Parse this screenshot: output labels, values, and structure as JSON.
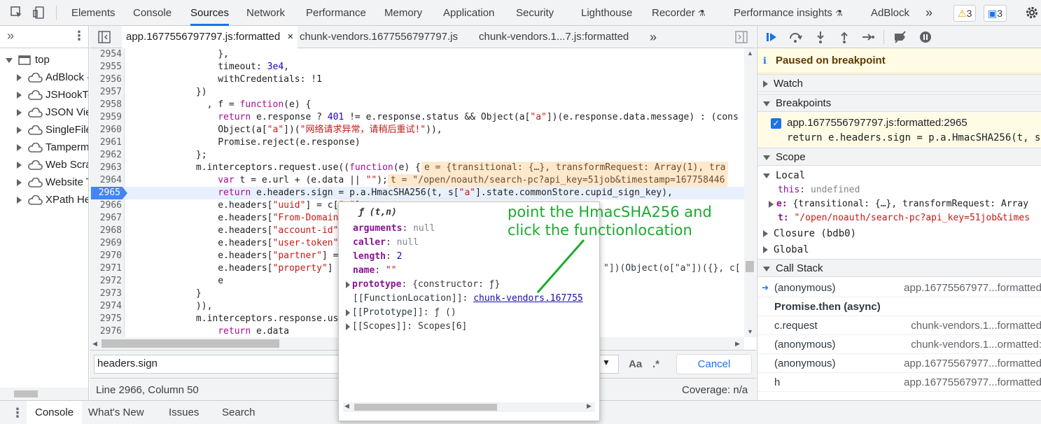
{
  "topbar": {
    "tabs": [
      "Elements",
      "Console",
      "Sources",
      "Network",
      "Performance",
      "Memory",
      "Application",
      "Security",
      "Lighthouse",
      "Recorder",
      "Performance insights",
      "AdBlock"
    ],
    "active_tab": "Sources",
    "more": "»",
    "warnings": "3",
    "messages": "3"
  },
  "navigator": {
    "more": "»",
    "top": "top",
    "items": [
      "AdBlock -",
      "JSHookTo",
      "JSON View",
      "SingleFile",
      "Tamperm",
      "Web Scrap",
      "Website T",
      "XPath Hel"
    ]
  },
  "editor": {
    "tabs": [
      "app.1677556797797.js:formatted",
      "chunk-vendors.1677556797797.js",
      "chunk-vendors.1...7.js:formatted"
    ],
    "close": "×",
    "more": "»"
  },
  "code": [
    {
      "n": "2954",
      "t": "                },"
    },
    {
      "n": "2955",
      "t": "                timeout: 3e4,"
    },
    {
      "n": "2956",
      "t": "                withCredentials: !1"
    },
    {
      "n": "2957",
      "t": "            })"
    },
    {
      "n": "2958",
      "t": "              , f = function(e) {"
    },
    {
      "n": "2959",
      "t": "                return e.response ? 401 != e.response.status && Object(a[\"a\"])(e.response.data.message) : (cons"
    },
    {
      "n": "2960",
      "t": "                Object(a[\"a\"])(\"网络请求异常，请稍后重试!\")),"
    },
    {
      "n": "2961",
      "t": "                Promise.reject(e.response)"
    },
    {
      "n": "2962",
      "t": "            };"
    },
    {
      "n": "2963",
      "t": "            m.interceptors.request.use((function(e) {"
    },
    {
      "n": "2964",
      "t": "                var t = e.url + (e.data || \"\");"
    },
    {
      "n": "2965",
      "t": "                return e.headers.sign = p.a.HmacSHA256(t, s[\"a\"].state.commonStore.cupid_sign_key),"
    },
    {
      "n": "2966",
      "t": "                e.headers[\"uuid\"] = c[\"a\"]..."
    },
    {
      "n": "2967",
      "t": "                e.headers[\"From-Domain\"]"
    },
    {
      "n": "2968",
      "t": "                e.headers[\"account-id\"]"
    },
    {
      "n": "2969",
      "t": "                e.headers[\"user-token\"]"
    },
    {
      "n": "2970",
      "t": "                e.headers[\"partner\"] = s"
    },
    {
      "n": "2971",
      "t": "                e.headers[\"property\"] = "
    },
    {
      "n": "2972",
      "t": "                e"
    },
    {
      "n": "2973",
      "t": "            }"
    },
    {
      "n": "2974",
      "t": "            )),"
    },
    {
      "n": "2975",
      "t": "            m.interceptors.response.use("
    },
    {
      "n": "2976",
      "t": "                return e.data"
    }
  ],
  "inline_values": {
    "line_2963": "e = {transitional: {…}, transformRequest: Array(1), tra",
    "line_2964": "t = \"/open/noauth/search-pc?api_key=51job&timestamp=167758446",
    "line_2971_tail": "\"])(Object(o[\"a\"])({}, c["
  },
  "search": {
    "value": "headers.sign",
    "case_label": "Aa",
    "regex_label": ".*",
    "cancel": "Cancel"
  },
  "status": {
    "position": "Line 2966, Column 50",
    "coverage": "Coverage: n/a"
  },
  "debugger": {
    "paused": "Paused on breakpoint",
    "watch": "Watch",
    "breakpoints": "Breakpoints",
    "bp_file": "app.1677556797797.js:formatted:2965",
    "bp_code": "return e.headers.sign = p.a.HmacSHA256(t, s[",
    "scope": "Scope",
    "local": "Local",
    "this_key": "this:",
    "this_val": "undefined",
    "e_key": "e:",
    "e_val": "{transitional: {…}, transformRequest: Array",
    "t_key": "t:",
    "t_val": "\"/open/noauth/search-pc?api_key=51job&times",
    "closure": "Closure (bdb0)",
    "global": "Global",
    "call_stack": "Call Stack",
    "frames": [
      {
        "name": "(anonymous)",
        "loc": "app.16775567977...formatted"
      },
      {
        "name": "Promise.then (async)",
        "loc": ""
      },
      {
        "name": "c.request",
        "loc": "chunk-vendors.1...formatted"
      },
      {
        "name": "(anonymous)",
        "loc": "chunk-vendors.1...ormatted:"
      },
      {
        "name": "(anonymous)",
        "loc": "app.16775567977...formatted"
      },
      {
        "name": "h",
        "loc": "app.16775567977...formatted"
      }
    ]
  },
  "popover": {
    "header": "ƒ (t,n)",
    "rows": [
      {
        "k": "arguments",
        "v": "null"
      },
      {
        "k": "caller",
        "v": "null"
      },
      {
        "k": "length",
        "v": "2"
      },
      {
        "k": "name",
        "v": "\"\""
      },
      {
        "k": "prototype",
        "v": "{constructor: ƒ}"
      },
      {
        "k": "[[FunctionLocation]]",
        "v": "chunk-vendors.167755"
      },
      {
        "k": "[[Prototype]]",
        "v": "ƒ ()"
      },
      {
        "k": "[[Scopes]]",
        "v": "Scopes[6]"
      }
    ]
  },
  "annotation": {
    "line1": "point the HmacSHA256 and",
    "line2": "click the functionlocation",
    "color": "#1aab2e"
  },
  "drawer": {
    "tabs": [
      "Console",
      "What's New",
      "Issues",
      "Search"
    ]
  }
}
